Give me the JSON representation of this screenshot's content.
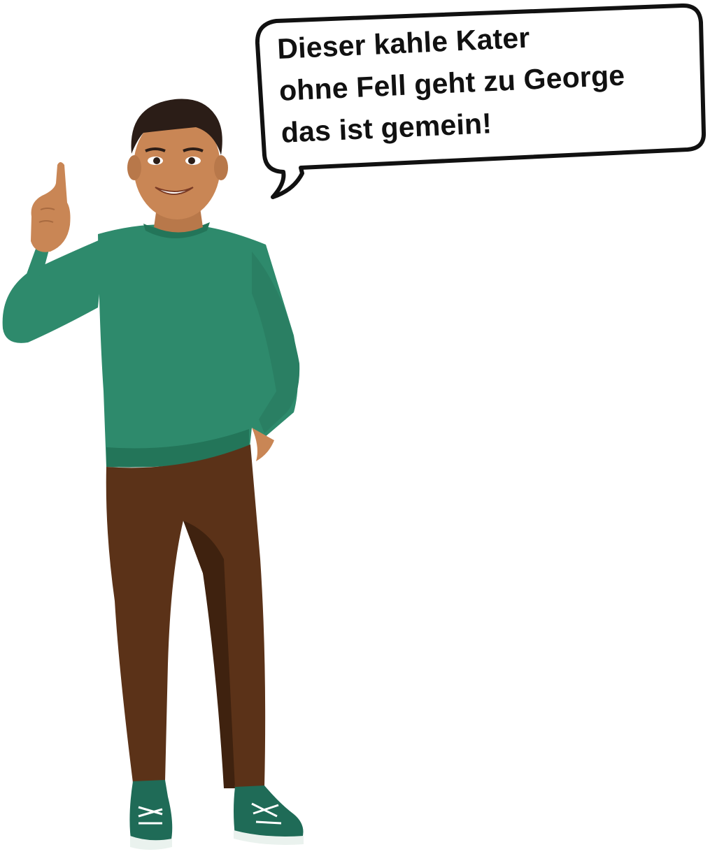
{
  "speech_bubble": {
    "lines": [
      "Dieser kahle Kater",
      "ohne Fell geht zu George",
      "das ist gemein!"
    ]
  },
  "figure": {
    "description_icon": "man-pointing-up-illustration",
    "colors": {
      "sweater": "#2e8a6c",
      "sweater_shade": "#237559",
      "pants": "#5b3218",
      "pants_shade": "#3f220f",
      "skin": "#c98655",
      "hair": "#2b1d17",
      "shoes": "#1f6b57",
      "bubble_stroke": "#111111"
    }
  }
}
